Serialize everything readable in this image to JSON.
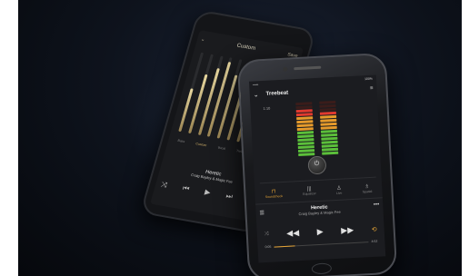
{
  "back_phone": {
    "header_title": "Custom",
    "header_right": "Save",
    "eq_levels": [
      0.55,
      0.75,
      0.85,
      0.95,
      0.8,
      0.7,
      0.6,
      0.5,
      0.45,
      0.4
    ],
    "tabs": [
      "Bass",
      "Custom",
      "Vocal",
      "Treble",
      "Rock"
    ],
    "now_playing_title": "Heretic",
    "now_playing_artist": "Craig Bayley & Magic Fee"
  },
  "front_phone": {
    "status_left": "•••••",
    "status_right": "100%",
    "header_title": "Treebeat",
    "left_label": "1:10",
    "right_label": "",
    "tabs": [
      {
        "icon": "⊓",
        "label": "Soundcheck",
        "selected": true
      },
      {
        "icon": "|||",
        "label": "Equalizer",
        "selected": false
      },
      {
        "icon": "♙",
        "label": "Live",
        "selected": false
      },
      {
        "icon": "♗",
        "label": "Spatial",
        "selected": false
      }
    ],
    "now_playing_title": "Heretic",
    "now_playing_artist": "Craig Bayley & Magic Fee",
    "time_left": "0:05",
    "time_right": "4:52",
    "progress": 0.22,
    "meter_left_level": 0.85,
    "meter_right_level": 0.78
  },
  "colors": {
    "accent": "#e5a436",
    "eq_fill": "#d8c58a"
  }
}
